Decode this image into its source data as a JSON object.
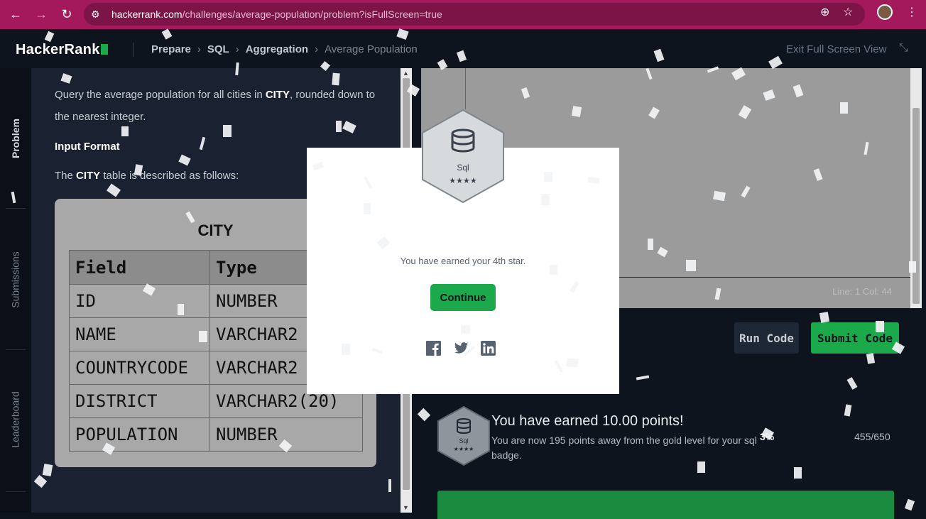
{
  "browser": {
    "url_host": "hackerrank.com",
    "url_path": "/challenges/average-population/problem?isFullScreen=true"
  },
  "header": {
    "logo": "HackerRank",
    "breadcrumbs": [
      "Prepare",
      "SQL",
      "Aggregation",
      "Average Population"
    ],
    "exit_fullscreen": "Exit Full Screen View"
  },
  "tabs": [
    "Problem",
    "Submissions",
    "Leaderboard"
  ],
  "problem": {
    "statement_pre": "Query the average population for all cities in ",
    "statement_table": "CITY",
    "statement_post": ", rounded down to the nearest integer.",
    "input_format_title": "Input Format",
    "table_desc_pre": "The ",
    "table_desc_table": "CITY",
    "table_desc_post": " table is described as follows:",
    "table_caption": "CITY",
    "table_headers": [
      "Field",
      "Type"
    ],
    "table_rows": [
      [
        "ID",
        "NUMBER"
      ],
      [
        "NAME",
        "VARCHAR2"
      ],
      [
        "COUNTRYCODE",
        "VARCHAR2"
      ],
      [
        "DISTRICT",
        "VARCHAR2(20)"
      ],
      [
        "POPULATION",
        "NUMBER"
      ]
    ]
  },
  "editor": {
    "status": "Line: 1 Col: 44",
    "run_label": "Run Code",
    "submit_label": "Submit Code"
  },
  "result": {
    "earned": "You have earned 10.00 points!",
    "subtext": "You are now 195 points away from the gold level for your sql badge.",
    "percent": "3%",
    "score": "455/650",
    "badge_name": "Sql",
    "badge_stars": 4
  },
  "modal": {
    "badge_name": "Sql",
    "badge_stars": 4,
    "message": "You have earned your 4th star.",
    "continue_label": "Continue",
    "social": [
      "facebook-icon",
      "twitter-icon",
      "linkedin-icon"
    ]
  },
  "colors": {
    "chrome": "#a3195b",
    "accent_green": "#1ba94c",
    "page_bg": "#0e141e"
  }
}
